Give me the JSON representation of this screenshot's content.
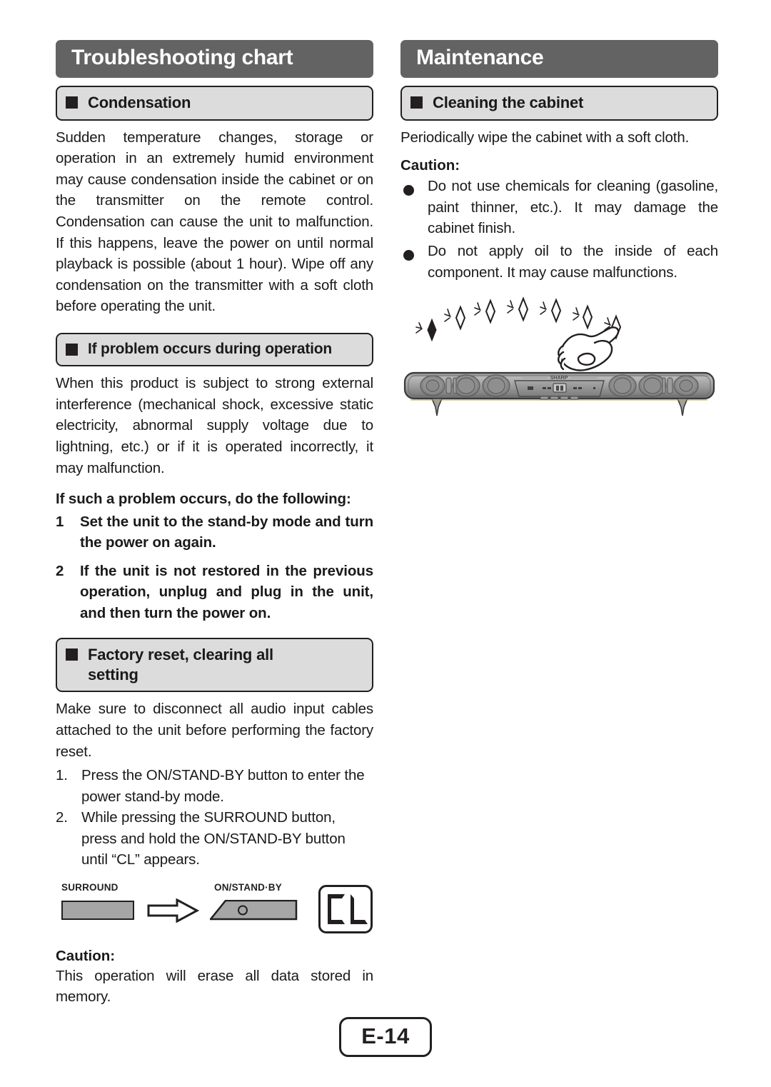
{
  "page": {
    "number_label": "E-14"
  },
  "left_column": {
    "banner": "Troubleshooting chart",
    "sections": [
      {
        "heading": "Condensation",
        "body": "Sudden temperature changes, storage or operation in an extremely humid environment may cause condensation inside the cabinet or on the transmitter on the remote control. Condensation can cause the unit to malfunction. If this happens, leave the power on until normal playback is possible (about 1 hour). Wipe off any condensation on the transmitter with a soft cloth before operating the unit."
      },
      {
        "heading": "If problem occurs during operation",
        "body": "When this product is subject to strong external interference (mechanical shock, excessive static electricity, abnormal supply voltage due to lightning, etc.) or if it is operated incorrectly, it may malfunction.",
        "bold_intro": "If such a problem occurs, do the following:",
        "steps": [
          {
            "num": "1",
            "text": "Set the unit to the stand-by mode and turn the power on again."
          },
          {
            "num": "2",
            "text": "If the unit is not restored in the previous operation, unplug and plug in the unit, and then turn the power on."
          }
        ]
      },
      {
        "heading_line1": "Factory reset, clearing all",
        "heading_line2": "setting",
        "body": "Make sure to disconnect all audio input cables attached to the unit before performing the factory reset.",
        "numbered": [
          {
            "num": "1.",
            "text": "Press the ON/STAND-BY button to enter the power stand-by mode."
          },
          {
            "num": "2.",
            "text": "While pressing the SURROUND button, press and hold the ON/STAND-BY button until “CL” appears."
          }
        ],
        "diagram": {
          "surround_label": "SURROUND",
          "onstandby_label": "ON/STAND·BY",
          "display_text": "CL"
        },
        "caution_label": "Caution:",
        "caution_text": "This operation will erase all data stored in memory."
      }
    ]
  },
  "right_column": {
    "banner": "Maintenance",
    "sections": [
      {
        "heading": "Cleaning the cabinet",
        "body": "Periodically wipe the cabinet with a soft cloth.",
        "caution_label": "Caution:",
        "bullets": [
          "Do not use chemicals for cleaning (gasoline, paint thinner, etc.). It may damage the cabinet finish.",
          "Do not apply oil to the inside of each component. It may cause malfunctions."
        ],
        "illustration": {
          "brand_logo": "SHARP",
          "alt": "hand wiping soundbar with sparkles"
        }
      }
    ]
  },
  "colors": {
    "banner_gray": "#636363",
    "section_gray": "#dcdcdc",
    "ink": "#231f20",
    "button_gray": "#a6a6a6"
  }
}
